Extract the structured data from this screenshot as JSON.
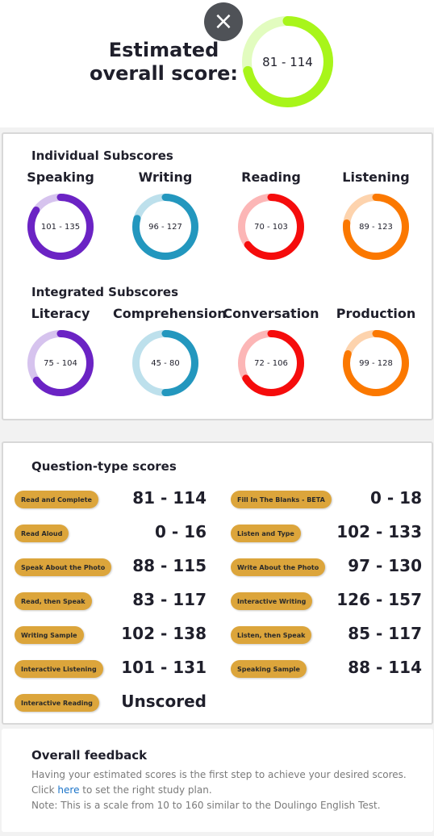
{
  "header": {
    "close_icon": "×",
    "title_line1": "Estimated",
    "title_line2": "overall score:",
    "overall_score": {
      "label": "81 - 114",
      "low": 81,
      "high": 114,
      "max": 160,
      "color": "#a8f51a",
      "track": "#e2fcbf"
    }
  },
  "individual": {
    "heading": "Individual Subscores",
    "items": [
      {
        "name": "Speaking",
        "label": "101 - 135",
        "low": 101,
        "high": 135,
        "color": "#6b23c4",
        "track": "#d6c3ee"
      },
      {
        "name": "Writing",
        "label": "96 - 127",
        "low": 96,
        "high": 127,
        "color": "#2397be",
        "track": "#bde0ec"
      },
      {
        "name": "Reading",
        "label": "70 - 103",
        "low": 70,
        "high": 103,
        "color": "#f50c0c",
        "track": "#fcb6b6"
      },
      {
        "name": "Listening",
        "label": "89 - 123",
        "low": 89,
        "high": 123,
        "color": "#fb7800",
        "track": "#fdd3ad"
      }
    ]
  },
  "integrated": {
    "heading": "Integrated Subscores",
    "items": [
      {
        "name": "Literacy",
        "label": "75 - 104",
        "low": 75,
        "high": 104,
        "color": "#6b23c4",
        "track": "#d6c3ee"
      },
      {
        "name": "Comprehension",
        "label": "45 - 80",
        "low": 45,
        "high": 80,
        "color": "#2397be",
        "track": "#bde0ec"
      },
      {
        "name": "Conversation",
        "label": "72 - 106",
        "low": 72,
        "high": 106,
        "color": "#f50c0c",
        "track": "#fcb6b6"
      },
      {
        "name": "Production",
        "label": "99 - 128",
        "low": 99,
        "high": 128,
        "color": "#fb7800",
        "track": "#fdd3ad"
      }
    ]
  },
  "scale_max": 160,
  "question_types": {
    "heading": "Question-type scores",
    "left": [
      {
        "name": "Read and Complete",
        "score": "81 - 114"
      },
      {
        "name": "Read Aloud",
        "score": "0 - 16"
      },
      {
        "name": "Speak About the Photo",
        "score": "88 - 115"
      },
      {
        "name": "Read, then Speak",
        "score": "83 - 117"
      },
      {
        "name": "Writing Sample",
        "score": "102 - 138"
      },
      {
        "name": "Interactive Listening",
        "score": "101 - 131"
      },
      {
        "name": "Interactive Reading",
        "score": "Unscored"
      }
    ],
    "right": [
      {
        "name": "Fill In The Blanks - BETA",
        "score": "0 - 18"
      },
      {
        "name": "Listen and Type",
        "score": "102 - 133"
      },
      {
        "name": "Write About the Photo",
        "score": "97 - 130"
      },
      {
        "name": "Interactive Writing",
        "score": "126 - 157"
      },
      {
        "name": "Listen, then Speak",
        "score": "85 - 117"
      },
      {
        "name": "Speaking Sample",
        "score": "88 - 114"
      }
    ]
  },
  "feedback": {
    "heading": "Overall feedback",
    "line1": "Having your estimated scores is the first step to achieve your desired scores.",
    "line2_pre": "Click ",
    "line2_link": "here",
    "line2_post": " to set the right study plan.",
    "line3": "Note: This is a scale from 10 to 160 similar to the Doulingo English Test."
  }
}
